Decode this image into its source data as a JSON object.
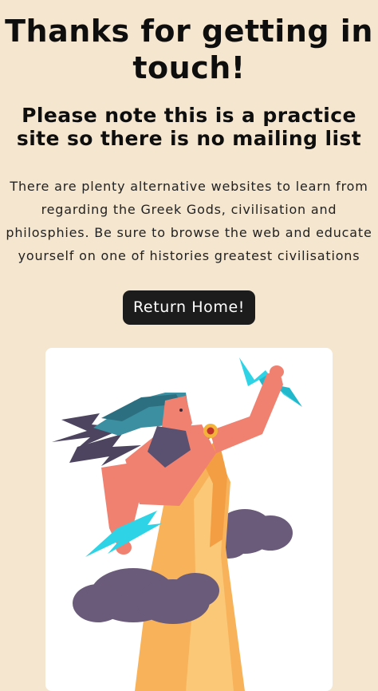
{
  "heading": {
    "title": "Thanks for getting in touch!",
    "subtitle_line1": "Please note this is a practice",
    "subtitle_line2": "site so there is no mailing list"
  },
  "message": {
    "lines": [
      "There are plenty alternative websites to learn from",
      "regarding the Greek Gods, civilisation and",
      "philosphies. Be sure to browse the web and educate",
      "yourself on one of histories greatest civilisations"
    ]
  },
  "actions": {
    "return_home_label": "Return Home!"
  },
  "illustration": {
    "subject": "zeus-with-lightning",
    "colors": {
      "page_bg": "#f5e6cf",
      "button_bg": "#1c1c1c",
      "hair": "#3b8fa0",
      "skin": "#f08070",
      "robe": "#f7b25a",
      "cloud": "#6b5b7a",
      "lightning_dark": "#4d4560",
      "lightning_light": "#2fd3e6"
    }
  }
}
